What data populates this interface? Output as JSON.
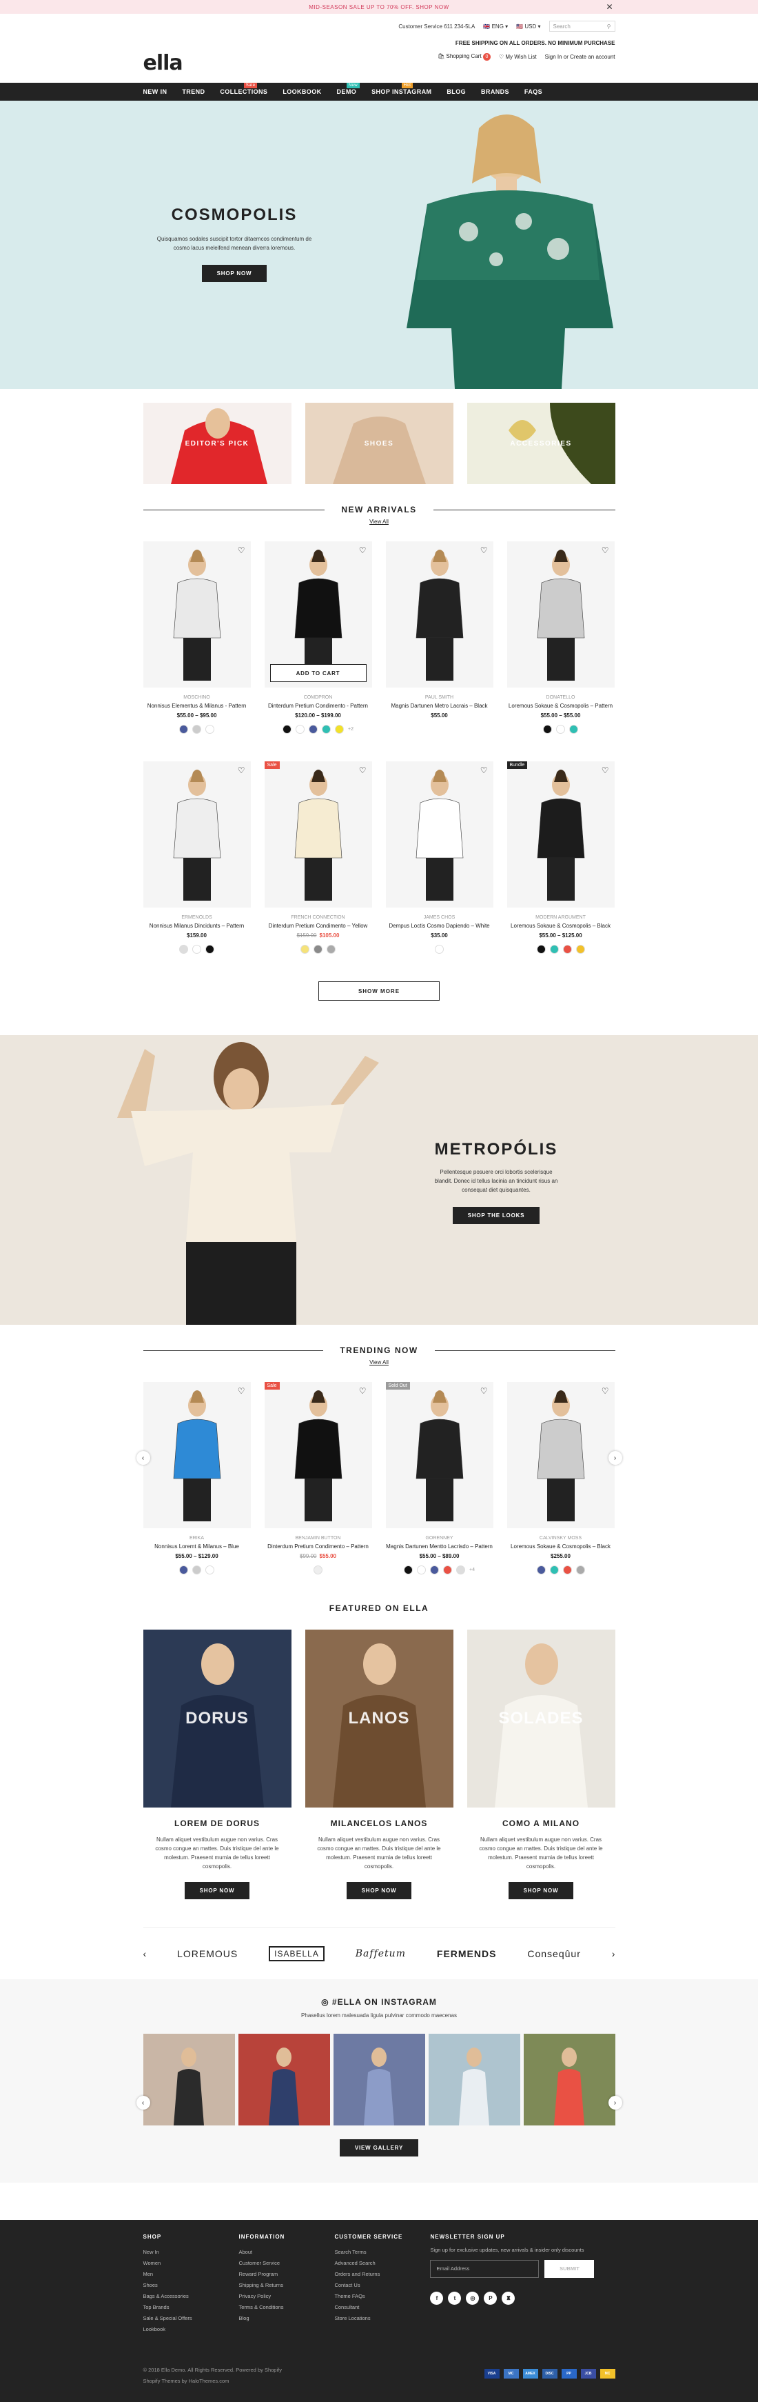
{
  "announcement": {
    "text": "Mid-season sale up to 70% off. Shop now"
  },
  "header": {
    "customer_service": "Customer Service 611 234-5LA",
    "language": "ENG",
    "currency": "USD",
    "search_placeholder": "Search",
    "logo": "ella",
    "free_shipping": "FREE SHIPPING ON ALL ORDERS. NO MINIMUM PURCHASE",
    "cart_label": "Shopping Cart",
    "cart_count": "0",
    "wishlist": "My Wish List",
    "signin": "Sign In or Create an account"
  },
  "nav": [
    {
      "label": "NEW IN",
      "badge": "",
      "badge_color": ""
    },
    {
      "label": "TREND",
      "badge": "",
      "badge_color": ""
    },
    {
      "label": "COLLECTIONS",
      "badge": "Sale",
      "badge_color": "#e95144"
    },
    {
      "label": "LOOKBOOK",
      "badge": "",
      "badge_color": ""
    },
    {
      "label": "DEMO",
      "badge": "New",
      "badge_color": "#2fbfb3"
    },
    {
      "label": "SHOP INSTAGRAM",
      "badge": "Hot",
      "badge_color": "#f0a12c"
    },
    {
      "label": "BLOG",
      "badge": "",
      "badge_color": ""
    },
    {
      "label": "BRANDS",
      "badge": "",
      "badge_color": ""
    },
    {
      "label": "FAQS",
      "badge": "",
      "badge_color": ""
    }
  ],
  "hero": {
    "title": "COSMOPOLIS",
    "desc": "Quisquamos sodales suscipit tortor ditaemcos condimentum de cosmo lacus meleifend menean diverra loremous.",
    "button": "SHOP NOW"
  },
  "categories": [
    {
      "label": "EDITOR'S PICK",
      "color": "#e8563f"
    },
    {
      "label": "SHOES",
      "color": "#e7d1bd"
    },
    {
      "label": "ACCESSORIES",
      "color": "#c8c7ae"
    }
  ],
  "new_arrivals": {
    "title": "NEW ARRIVALS",
    "view_all": "View All",
    "add_to_cart": "ADD TO CART",
    "show_more": "SHOW MORE"
  },
  "products": [
    {
      "brand": "Moschino",
      "name": "Nonnisus Elementus & Milanus - Pattern",
      "price": "$55.00 – $95.00",
      "old": "",
      "tag": "",
      "tag_color": "",
      "swatches": [
        "#4a5a9c",
        "#cccccc",
        "#ffffff"
      ],
      "more": ""
    },
    {
      "brand": "Comdpron",
      "name": "Dinterdum Pretium Condimento - Pattern",
      "price": "$120.00 – $199.00",
      "old": "",
      "tag": "",
      "tag_color": "",
      "swatches": [
        "#111111",
        "#ffffff",
        "#4a5a9c",
        "#2fbfb3",
        "#f2e12a"
      ],
      "more": "+2"
    },
    {
      "brand": "Paul Smith",
      "name": "Magnis Dartunen Metro Lacrais – Black",
      "price": "$55.00",
      "old": "",
      "tag": "",
      "tag_color": "",
      "swatches": [],
      "more": ""
    },
    {
      "brand": "Donatello",
      "name": "Loremous Sokaue & Cosmopolis – Pattern",
      "price": "$55.00 – $55.00",
      "old": "",
      "tag": "",
      "tag_color": "",
      "swatches": [
        "#111111",
        "#ffffff",
        "#2fbfb3"
      ],
      "more": ""
    },
    {
      "brand": "Ermenolds",
      "name": "Nonnisus Milanus Dincidunts – Pattern",
      "price": "$159.00",
      "old": "",
      "tag": "",
      "tag_color": "",
      "swatches": [
        "#dddddd",
        "#ffffff",
        "#111111"
      ],
      "more": ""
    },
    {
      "brand": "French Connection",
      "name": "Dinterdum Pretium Condimento – Yellow",
      "price": "$105.00",
      "old": "$159.00",
      "tag": "Sale",
      "tag_color": "#e95144",
      "swatches": [
        "#f5e27a",
        "#8a8a8a",
        "#aaaaaa"
      ],
      "more": ""
    },
    {
      "brand": "James Chos",
      "name": "Dempus Loctis Cosmo Dapiendo – White",
      "price": "$35.00",
      "old": "",
      "tag": "",
      "tag_color": "",
      "swatches": [
        "#ffffff"
      ],
      "more": ""
    },
    {
      "brand": "Modern Argument",
      "name": "Loremous Sokaue & Cosmopolis – Black",
      "price": "$55.00 – $125.00",
      "old": "",
      "tag": "Bundle",
      "tag_color": "#232323",
      "swatches": [
        "#111111",
        "#2fbfb3",
        "#e95144",
        "#f2c12a"
      ],
      "more": ""
    }
  ],
  "banner2": {
    "title": "METROPÓLIS",
    "desc": "Pellentesque posuere orci lobortis scelerisque blandit. Donec id tellus lacinia an tincidunt risus an consequat diet quisquantes.",
    "button": "SHOP THE LOOKS"
  },
  "trending": {
    "title": "TRENDING NOW",
    "view_all": "View All"
  },
  "trending_products": [
    {
      "brand": "Erika",
      "name": "Nonnisus Loremt & Milanus – Blue",
      "price": "$55.00 – $129.00",
      "old": "",
      "tag": "",
      "tag_color": "",
      "swatches": [
        "#4a5a9c",
        "#cccccc",
        "#ffffff"
      ],
      "more": ""
    },
    {
      "brand": "Benjamin Button",
      "name": "Dinterdum Pretium Condimento – Pattern",
      "price": "$55.00",
      "old": "$99.00",
      "tag": "Sale",
      "tag_color": "#e95144",
      "swatches": [
        "#eeeeee"
      ],
      "more": ""
    },
    {
      "brand": "Gorenney",
      "name": "Magnis Dartunen Mentto Lacrisdo – Pattern",
      "price": "$55.00 – $89.00",
      "old": "",
      "tag": "Sold Out",
      "tag_color": "#9b9b9b",
      "swatches": [
        "#111111",
        "#ffffff",
        "#4a5a9c",
        "#e95144",
        "#dddddd"
      ],
      "more": "+4"
    },
    {
      "brand": "Calvinsky Moss",
      "name": "Loremous Sokaue & Cosmopolis – Black",
      "price": "$255.00",
      "old": "",
      "tag": "",
      "tag_color": "",
      "swatches": [
        "#4a5a9c",
        "#2fbfb3",
        "#e95144",
        "#aaaaaa"
      ],
      "more": ""
    }
  ],
  "featured": {
    "title": "FEATURED ON ELLA",
    "items": [
      {
        "overlay": "DORUS",
        "title": "LOREM DE DORUS",
        "desc": "Nullam aliquet vestibulum augue non varius. Cras cosmo congue an mattes. Duis tristique del ante le molestum. Praesent mumia de tellus loreett cosmopolis.",
        "button": "SHOP NOW",
        "color": "#2c3a55"
      },
      {
        "overlay": "LANOS",
        "title": "MILANCELOS LANOS",
        "desc": "Nullam aliquet vestibulum augue non varius. Cras cosmo congue an mattes. Duis tristique del ante le molestum. Praesent mumia de tellus loreett cosmopolis.",
        "button": "SHOP NOW",
        "color": "#8a6a4e"
      },
      {
        "overlay": "SOLADES",
        "title": "COMO A MILANO",
        "desc": "Nullam aliquet vestibulum augue non varius. Cras cosmo congue an mattes. Duis tristique del ante le molestum. Praesent mumia de tellus loreett cosmopolis.",
        "button": "SHOP NOW",
        "color": "#e9e6df"
      }
    ]
  },
  "brands": [
    "LOREMOUS",
    "ISABELLA",
    "Baffetum",
    "FERMENDS",
    "Conseqûur"
  ],
  "instagram": {
    "title": "#ELLA ON INSTAGRAM",
    "sub": "Phasellus lorem malesuada ligula pulvinar commodo maecenas",
    "button": "VIEW GALLERY",
    "colors": [
      "#c9b6a6",
      "#b8433a",
      "#6d7aa3",
      "#aec4cf",
      "#7e8a57"
    ]
  },
  "footer": {
    "cols": [
      {
        "title": "SHOP",
        "items": [
          "New In",
          "Women",
          "Men",
          "Shoes",
          "Bags & Accessories",
          "Top Brands",
          "Sale & Special Offers",
          "Lookbook"
        ]
      },
      {
        "title": "INFORMATION",
        "items": [
          "About",
          "Customer Service",
          "Reward Program",
          "Shipping & Returns",
          "Privacy Policy",
          "Terms & Conditions",
          "Blog"
        ]
      },
      {
        "title": "CUSTOMER SERVICE",
        "items": [
          "Search Terms",
          "Advanced Search",
          "Orders and Returns",
          "Contact Us",
          "Theme FAQs",
          "Consultant",
          "Store Locations"
        ]
      }
    ],
    "newsletter_title": "NEWSLETTER SIGN UP",
    "newsletter_text": "Sign up for exclusive updates, new arrivals & insider only discounts",
    "email_placeholder": "Email Address",
    "submit": "SUBMIT",
    "social": [
      "f",
      "t",
      "◎",
      "P",
      "♜"
    ],
    "copyright": "© 2018 Ella Demo. All Rights Reserved. Powered by Shopify",
    "credit": "Shopify Themes by HaloThemes.com",
    "payments": [
      {
        "label": "VISA",
        "color": "#1a3f8f"
      },
      {
        "label": "MC",
        "color": "#3b74c4"
      },
      {
        "label": "AMEX",
        "color": "#3a8bd6"
      },
      {
        "label": "DISC",
        "color": "#2d5fa8"
      },
      {
        "label": "PP",
        "color": "#2a68c8"
      },
      {
        "label": "JCB",
        "color": "#3a4ea3"
      },
      {
        "label": "MC",
        "color": "#f2c12a"
      }
    ]
  }
}
